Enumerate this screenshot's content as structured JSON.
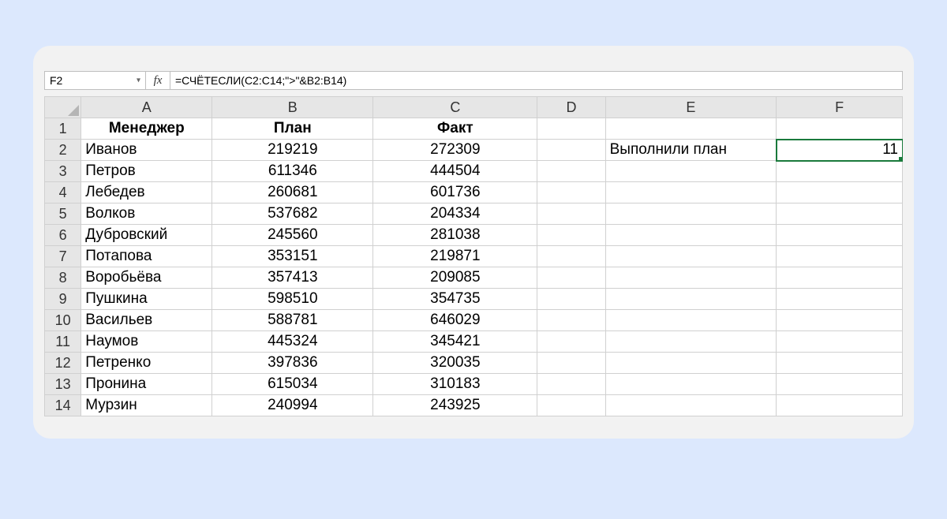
{
  "nameBox": "F2",
  "fxLabel": "fx",
  "formula": "=СЧЁТЕСЛИ(C2:C14;\">\"&B2:B14)",
  "columns": [
    "A",
    "B",
    "C",
    "D",
    "E",
    "F"
  ],
  "rowHeaders": [
    1,
    2,
    3,
    4,
    5,
    6,
    7,
    8,
    9,
    10,
    11,
    12,
    13,
    14
  ],
  "headers": {
    "A": "Менеджер",
    "B": "План",
    "C": "Факт"
  },
  "data": [
    {
      "m": "Иванов",
      "p": "219219",
      "f": "272309"
    },
    {
      "m": "Петров",
      "p": "611346",
      "f": "444504"
    },
    {
      "m": "Лебедев",
      "p": "260681",
      "f": "601736"
    },
    {
      "m": "Волков",
      "p": "537682",
      "f": "204334"
    },
    {
      "m": "Дубровский",
      "p": "245560",
      "f": "281038"
    },
    {
      "m": "Потапова",
      "p": "353151",
      "f": "219871"
    },
    {
      "m": "Воробьёва",
      "p": "357413",
      "f": "209085"
    },
    {
      "m": "Пушкина",
      "p": "598510",
      "f": "354735"
    },
    {
      "m": "Васильев",
      "p": "588781",
      "f": "646029"
    },
    {
      "m": "Наумов",
      "p": "445324",
      "f": "345421"
    },
    {
      "m": "Петренко",
      "p": "397836",
      "f": "320035"
    },
    {
      "m": "Пронина",
      "p": "615034",
      "f": "310183"
    },
    {
      "m": "Мурзин",
      "p": "240994",
      "f": "243925"
    }
  ],
  "e2": "Выполнили план",
  "f2": "11",
  "selectedCell": "F2"
}
